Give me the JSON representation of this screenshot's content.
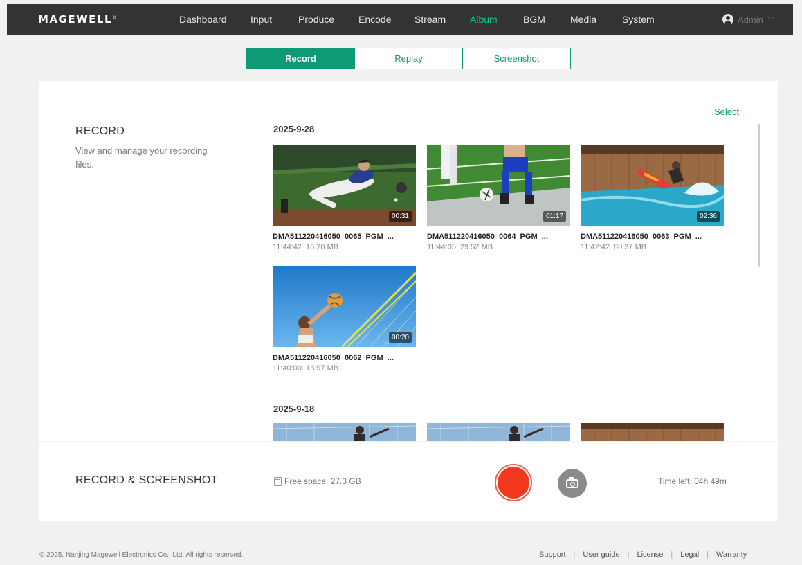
{
  "brand": "MAGEWELL",
  "nav": {
    "items": [
      "Dashboard",
      "Input",
      "Produce",
      "Encode",
      "Stream",
      "Album",
      "BGM",
      "Media",
      "System"
    ],
    "active": "Album",
    "user": "Admin"
  },
  "tabs": [
    "Record",
    "Replay",
    "Screenshot"
  ],
  "record": {
    "title": "RECORD",
    "description": "View and manage your recording files.",
    "select_label": "Select"
  },
  "groups": [
    {
      "date": "2025-9-28",
      "files": [
        {
          "name": "DMA511220416050_0065_PGM_...",
          "time": "11:44:42",
          "size": "16.20 MB",
          "duration": "00:31",
          "thumb": "baseball"
        },
        {
          "name": "DMA511220416050_0064_PGM_...",
          "time": "11:44:05",
          "size": "29.52 MB",
          "duration": "01:17",
          "thumb": "soccer"
        },
        {
          "name": "DMA511220416050_0063_PGM_...",
          "time": "11:42:42",
          "size": "80.37 MB",
          "duration": "02:36",
          "thumb": "surfing"
        },
        {
          "name": "DMA511220416050_0062_PGM_...",
          "time": "11:40:00",
          "size": "13.97 MB",
          "duration": "00:20",
          "thumb": "volleyball"
        }
      ]
    },
    {
      "date": "2025-9-18",
      "files": []
    }
  ],
  "bottom": {
    "title": "RECORD & SCREENSHOT",
    "free_space": "Free space: 27.3 GB",
    "time_left": "Time left: 04h 49m"
  },
  "footer": {
    "copyright": "© 2025, Nanjing Magewell Electronics Co., Ltd. All rights reserved.",
    "links": [
      "Support",
      "User guide",
      "License",
      "Legal",
      "Warranty"
    ]
  },
  "colors": {
    "accent": "#0e9a74",
    "nav_bg": "#333333",
    "record": "#f0381c"
  }
}
